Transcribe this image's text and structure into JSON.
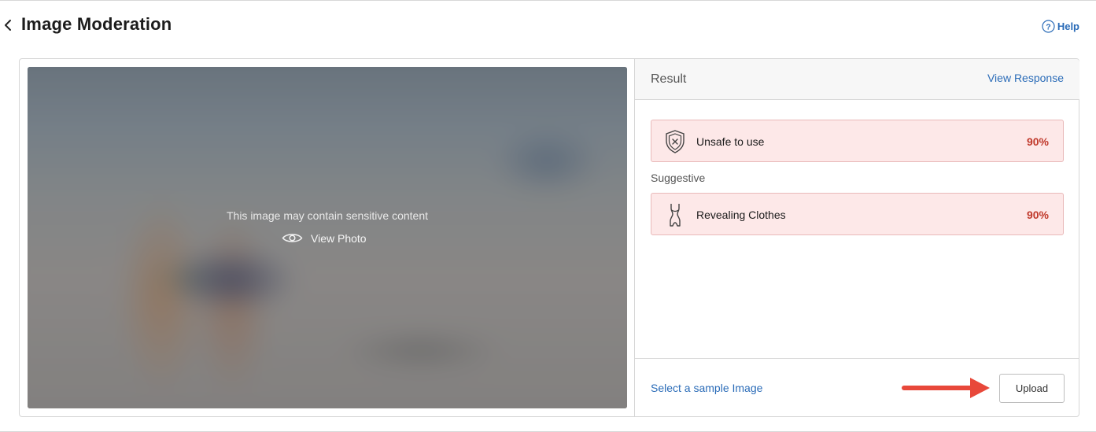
{
  "header": {
    "title": "Image Moderation",
    "help_label": "Help"
  },
  "preview": {
    "warning_text": "This image may contain sensitive content",
    "view_photo_label": "View Photo"
  },
  "result": {
    "title": "Result",
    "view_response_label": "View Response",
    "summary": {
      "label": "Unsafe to use",
      "value": "90%",
      "icon": "shield-x-icon"
    },
    "category": "Suggestive",
    "items": [
      {
        "label": "Revealing Clothes",
        "value": "90%",
        "icon": "swimsuit-icon"
      }
    ],
    "sample_link_label": "Select a sample Image",
    "upload_label": "Upload"
  },
  "colors": {
    "accent": "#2b6cb8",
    "alert_bg": "#fde8e8",
    "alert_border": "#e9b9b9",
    "alert_value": "#c0392b",
    "annotation_arrow": "#e8483a"
  }
}
